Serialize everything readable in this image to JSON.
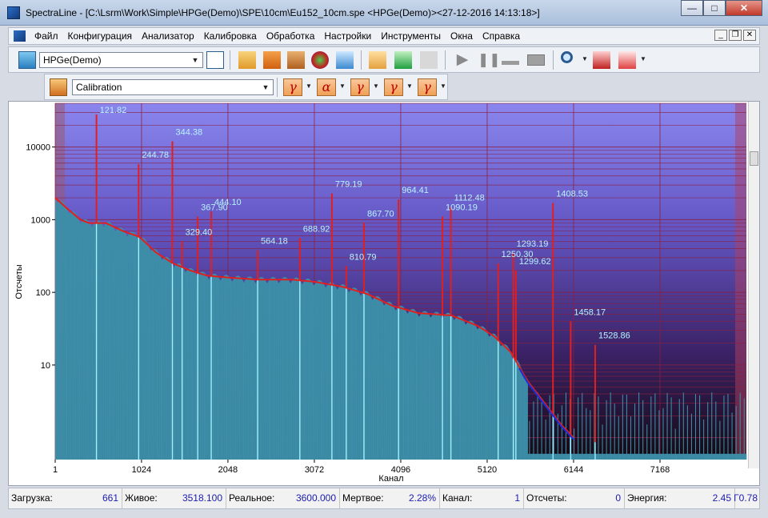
{
  "window": {
    "title": "SpectraLine - [C:\\Lsrm\\Work\\Simple\\HPGe(Demo)\\SPE\\10cm\\Eu152_10cm.spe <HPGe(Demo)><27-12-2016 14:13:18>]"
  },
  "menu": [
    "Файл",
    "Конфигурация",
    "Анализатор",
    "Калибровка",
    "Обработка",
    "Настройки",
    "Инструменты",
    "Окна",
    "Справка"
  ],
  "toolbar": {
    "detector": "HPGe(Demo)",
    "mode": "Calibration"
  },
  "nuclide_buttons": [
    "γ",
    "α",
    "γ",
    "γ",
    "γ"
  ],
  "status": {
    "load_label": "Загрузка:",
    "load_value": "661",
    "live_label": "Живое:",
    "live_value": "3518.100",
    "real_label": "Реальное:",
    "real_value": "3600.000",
    "dead_label": "Мертвое:",
    "dead_value": "2.28%",
    "channel_label": "Канал:",
    "channel_value": "1",
    "counts_label": "Отсчеты:",
    "counts_value": "0",
    "energy_label": "Энергия:",
    "energy_value": "2.45",
    "extra_value": "Г0.78"
  },
  "colors": {
    "plot_bg_top": "#8a86ee",
    "plot_bg_bottom": "#140a12",
    "spectrum_fill": "#3d8ea8",
    "peak_line": "#9fefff",
    "fit_line": "#e02020",
    "grid": "#8a2040",
    "peak_label": "#b7f4ff"
  },
  "chart_data": {
    "type": "area",
    "title": "",
    "xlabel": "Канал",
    "ylabel": "Отсчеты",
    "xlim": [
      1,
      8192
    ],
    "ylim": [
      0.5,
      40000
    ],
    "y_scale": "log",
    "grid": true,
    "x_ticks": [
      "1",
      "1024",
      "2048",
      "3072",
      "4096",
      "5120",
      "6144",
      "7168"
    ],
    "x_tick_values": [
      1,
      1024,
      2048,
      3072,
      4096,
      5120,
      6144,
      7168
    ],
    "y_ticks": [
      "10",
      "100",
      "1000",
      "10000"
    ],
    "y_tick_values": [
      10,
      100,
      1000,
      10000
    ],
    "peaks": [
      {
        "energy": "121.82",
        "channel": 490,
        "height": 28000
      },
      {
        "energy": "244.78",
        "channel": 990,
        "height": 5800
      },
      {
        "energy": "344.38",
        "channel": 1390,
        "height": 12000
      },
      {
        "energy": "367.90",
        "channel": 1690,
        "height": 1100
      },
      {
        "energy": "444.10",
        "channel": 1850,
        "height": 1300
      },
      {
        "energy": "329.40",
        "channel": 1505,
        "height": 500
      },
      {
        "energy": "564.18",
        "channel": 2400,
        "height": 380
      },
      {
        "energy": "688.92",
        "channel": 2900,
        "height": 560
      },
      {
        "energy": "779.19",
        "channel": 3280,
        "height": 2300
      },
      {
        "energy": "810.79",
        "channel": 3450,
        "height": 230
      },
      {
        "energy": "867.70",
        "channel": 3660,
        "height": 900
      },
      {
        "energy": "964.41",
        "channel": 4070,
        "height": 1900
      },
      {
        "energy": "1090.19",
        "channel": 4590,
        "height": 1100
      },
      {
        "energy": "1112.48",
        "channel": 4690,
        "height": 1500
      },
      {
        "energy": "1250.30",
        "channel": 5250,
        "height": 250
      },
      {
        "energy": "1293.19",
        "channel": 5430,
        "height": 350
      },
      {
        "energy": "1299.62",
        "channel": 5460,
        "height": 200
      },
      {
        "energy": "1408.53",
        "channel": 5900,
        "height": 1700
      },
      {
        "energy": "1458.17",
        "channel": 6110,
        "height": 40
      },
      {
        "energy": "1528.86",
        "channel": 6400,
        "height": 19
      }
    ],
    "continuum": [
      [
        1,
        2000
      ],
      [
        150,
        1400
      ],
      [
        300,
        1000
      ],
      [
        400,
        900
      ],
      [
        600,
        900
      ],
      [
        800,
        700
      ],
      [
        1000,
        580
      ],
      [
        1200,
        350
      ],
      [
        1400,
        250
      ],
      [
        1600,
        200
      ],
      [
        1800,
        170
      ],
      [
        2048,
        160
      ],
      [
        2400,
        150
      ],
      [
        2800,
        150
      ],
      [
        3072,
        140
      ],
      [
        3400,
        120
      ],
      [
        3700,
        95
      ],
      [
        4000,
        65
      ],
      [
        4300,
        52
      ],
      [
        4700,
        48
      ],
      [
        5000,
        35
      ],
      [
        5200,
        25
      ],
      [
        5400,
        15
      ],
      [
        5600,
        6
      ],
      [
        5800,
        3
      ],
      [
        6000,
        1.5
      ],
      [
        6144,
        1
      ],
      [
        6300,
        0.9
      ],
      [
        6600,
        0.8
      ],
      [
        7000,
        0.8
      ],
      [
        7400,
        0.8
      ],
      [
        7900,
        0.8
      ]
    ]
  }
}
